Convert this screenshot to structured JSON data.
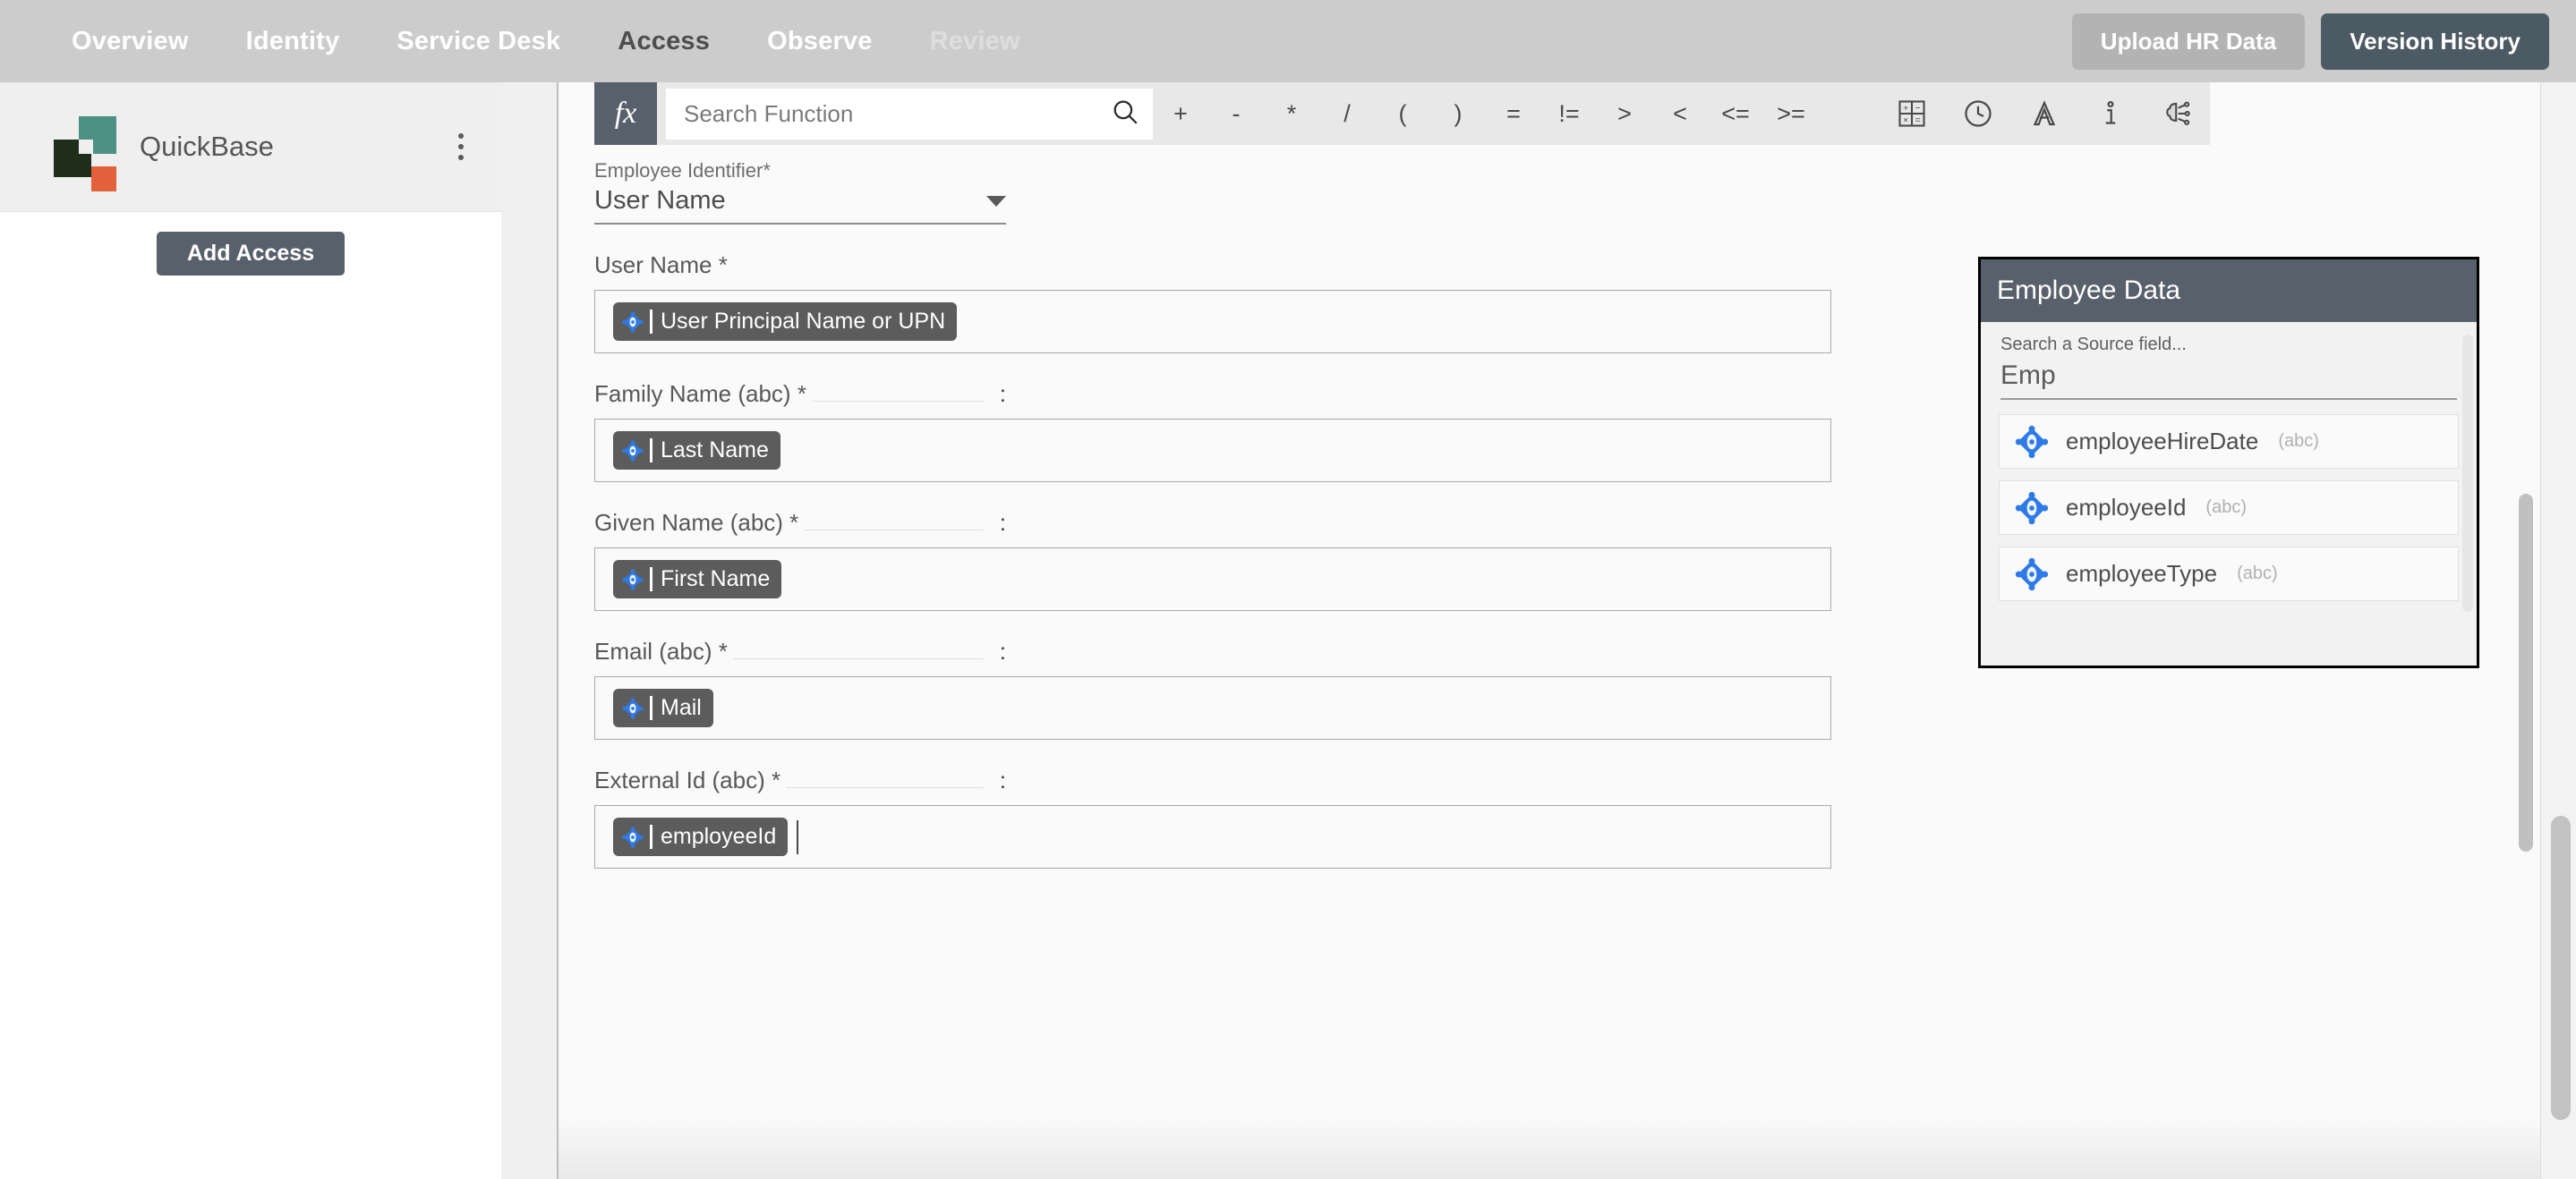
{
  "topnav": {
    "tabs": [
      {
        "label": "Overview",
        "state": "normal"
      },
      {
        "label": "Identity",
        "state": "normal"
      },
      {
        "label": "Service Desk",
        "state": "normal"
      },
      {
        "label": "Access",
        "state": "active"
      },
      {
        "label": "Observe",
        "state": "normal"
      },
      {
        "label": "Review",
        "state": "muted"
      }
    ],
    "upload_label": "Upload HR Data",
    "version_label": "Version History",
    "bg_color": "#cccccc",
    "version_color": "#4c5a64"
  },
  "sidebar": {
    "app_name": "QuickBase",
    "menu_icon": "kebab-menu-icon",
    "add_access_label": "Add Access",
    "logo_colors": {
      "teal": "#4c9183",
      "dark": "#1e2e1a",
      "orange": "#e2613b"
    }
  },
  "toolbar": {
    "fx_label": "fx",
    "search_placeholder": "Search Function",
    "search_value": "",
    "search_icon": "search-icon",
    "operators": [
      "+",
      "-",
      "*",
      "/",
      "(",
      ")",
      "=",
      "!=",
      ">",
      "<",
      "<=",
      ">="
    ],
    "icons": [
      "calculator-icon",
      "clock-icon",
      "text-format-icon",
      "info-icon",
      "ai-brain-icon"
    ]
  },
  "form": {
    "identifier": {
      "label": "Employee Identifier*",
      "value": "User Name",
      "dropdown_icon": "chevron-down-icon"
    },
    "fields": [
      {
        "label": "User Name *",
        "ruled": false,
        "colon": "",
        "tokens": [
          {
            "text": "User Principal Name or UPN",
            "icon": "source-field-icon"
          }
        ],
        "caret": false
      },
      {
        "label": "Family Name (abc) *",
        "ruled": true,
        "colon": ":",
        "tokens": [
          {
            "text": "Last Name",
            "icon": "source-field-icon"
          }
        ],
        "caret": false
      },
      {
        "label": "Given Name (abc) *",
        "ruled": true,
        "colon": ":",
        "tokens": [
          {
            "text": "First Name",
            "icon": "source-field-icon"
          }
        ],
        "caret": false
      },
      {
        "label": "Email (abc) *",
        "ruled": true,
        "colon": ":",
        "tokens": [
          {
            "text": "Mail",
            "icon": "source-field-icon"
          }
        ],
        "caret": false
      },
      {
        "label": "External Id (abc) *",
        "ruled": true,
        "colon": ":",
        "tokens": [
          {
            "text": "employeeId",
            "icon": "source-field-icon"
          }
        ],
        "caret": true
      }
    ]
  },
  "employee_panel": {
    "title": "Employee Data",
    "search_placeholder": "Search a Source field...",
    "search_value": "Emp",
    "items": [
      {
        "name": "employeeHireDate",
        "type": "(abc)",
        "icon": "source-field-icon"
      },
      {
        "name": "employeeId",
        "type": "(abc)",
        "icon": "source-field-icon"
      },
      {
        "name": "employeeType",
        "type": "(abc)",
        "icon": "source-field-icon"
      }
    ],
    "header_color": "#58616b"
  }
}
